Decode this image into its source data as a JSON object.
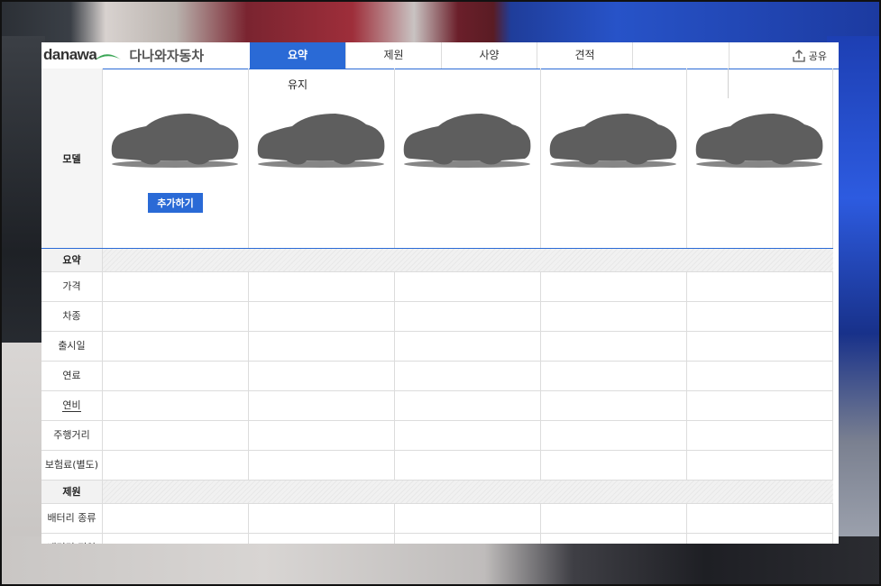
{
  "header": {
    "logo_en": "danawa",
    "logo_ko": "다나와자동차",
    "tabs": [
      {
        "label": "요약",
        "active": true
      },
      {
        "label": "제원",
        "active": false
      },
      {
        "label": "사양",
        "active": false
      },
      {
        "label": "견적",
        "active": false
      }
    ],
    "share_label": "공유",
    "share_icon": "share-upload-icon"
  },
  "floating_label": "유지",
  "model_row": {
    "label": "모델",
    "add_button": "추가하기",
    "car_icon": "car-silhouette-icon"
  },
  "sections": [
    {
      "title": "요약",
      "rows": [
        {
          "label": "가격"
        },
        {
          "label": "차종"
        },
        {
          "label": "출시일"
        },
        {
          "label": "연료"
        },
        {
          "label": "연비"
        },
        {
          "label": "주행거리"
        },
        {
          "label": "보험료(별도)"
        }
      ]
    },
    {
      "title": "제원",
      "rows": [
        {
          "label": "배터리 종류"
        },
        {
          "label": "배터리 전압"
        }
      ]
    }
  ],
  "colors": {
    "accent": "#2a6ad6",
    "logo_green": "#3aa655"
  }
}
